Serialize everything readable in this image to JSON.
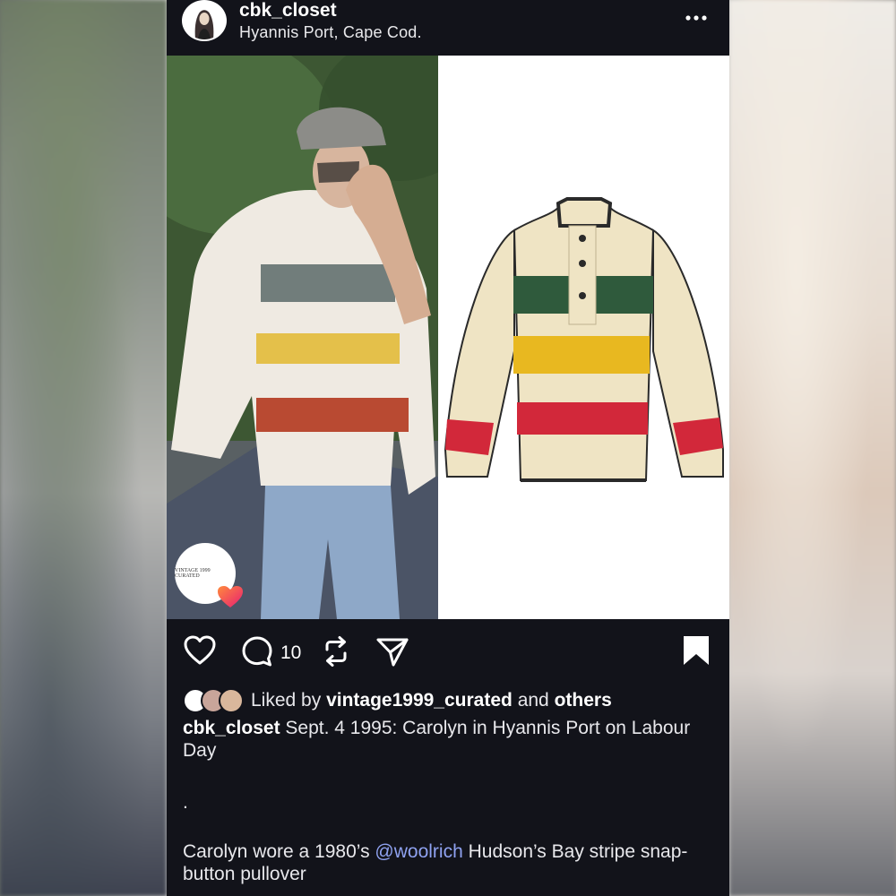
{
  "header": {
    "username": "cbk_closet",
    "location": "Hyannis Port, Cape Cod."
  },
  "media": {
    "watermark_text": "VINTAGE 1999 CURATED"
  },
  "actions": {
    "comment_count": "10"
  },
  "likes": {
    "prefix": "Liked by",
    "user": "vintage1999_curated",
    "middle": "and",
    "others": "others"
  },
  "caption": {
    "username": "cbk_closet",
    "text": "Sept. 4 1995: Carolyn in Hyannis Port on Labour Day",
    "dot": ".",
    "text2_before": "Carolyn wore a 1980’s",
    "mention": "@woolrich",
    "text2_after": "Hudson’s Bay stripe snap-button pullover"
  },
  "colors": {
    "background": "#12131a",
    "mention": "#8fa2f0",
    "stripe_green": "#2f5a3c",
    "stripe_yellow": "#e8b820",
    "stripe_red": "#d2283a",
    "cream": "#efe4c4"
  }
}
